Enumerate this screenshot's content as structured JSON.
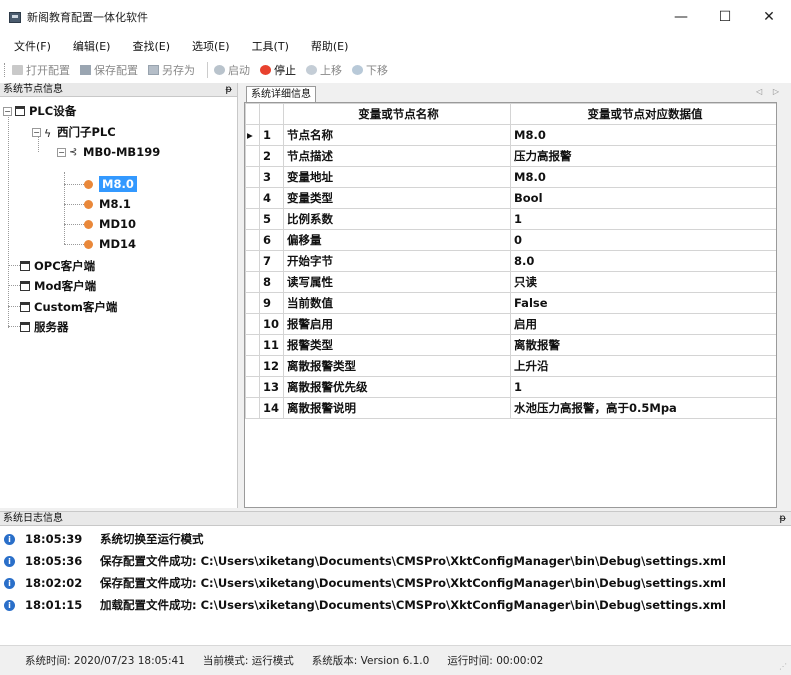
{
  "window": {
    "title": "新阁教育配置一体化软件",
    "controls": {
      "minimize": "—",
      "maximize": "☐",
      "close": "✕"
    }
  },
  "menu": [
    {
      "label": "文件(F)"
    },
    {
      "label": "编辑(E)"
    },
    {
      "label": "查找(E)"
    },
    {
      "label": "选项(E)"
    },
    {
      "label": "工具(T)"
    },
    {
      "label": "帮助(E)"
    }
  ],
  "toolbar": {
    "open": "打开配置",
    "save": "保存配置",
    "save_as": "另存为",
    "start": "启动",
    "stop": "停止",
    "move_up": "上移",
    "move_down": "下移"
  },
  "tree_panel": {
    "title": "系统节点信息",
    "pin": "ᵽ",
    "nodes": {
      "plc_devices": "PLC设备",
      "siemens_plc": "西门子PLC",
      "group": "MB0-MB199",
      "tag_1": "M8.0",
      "tag_2": "M8.1",
      "tag_3": "MD10",
      "tag_4": "MD14",
      "opc": "OPC客户端",
      "mod": "Mod客户端",
      "custom": "Custom客户端",
      "server": "服务器"
    }
  },
  "detail_panel": {
    "tab": "系统详细信息",
    "tab_nav": "◁ ▷",
    "columns": [
      "变量或节点名称",
      "变量或节点对应数据值"
    ],
    "current_row_marker": "▸",
    "rows": [
      {
        "idx": "1",
        "name": "节点名称",
        "value": "M8.0"
      },
      {
        "idx": "2",
        "name": "节点描述",
        "value": "压力高报警"
      },
      {
        "idx": "3",
        "name": "变量地址",
        "value": "M8.0"
      },
      {
        "idx": "4",
        "name": "变量类型",
        "value": "Bool"
      },
      {
        "idx": "5",
        "name": "比例系数",
        "value": "1"
      },
      {
        "idx": "6",
        "name": "偏移量",
        "value": "0"
      },
      {
        "idx": "7",
        "name": "开始字节",
        "value": "8.0"
      },
      {
        "idx": "8",
        "name": "读写属性",
        "value": "只读"
      },
      {
        "idx": "9",
        "name": "当前数值",
        "value": "False"
      },
      {
        "idx": "10",
        "name": "报警启用",
        "value": "启用"
      },
      {
        "idx": "11",
        "name": "报警类型",
        "value": "离散报警"
      },
      {
        "idx": "12",
        "name": "离散报警类型",
        "value": "上升沿"
      },
      {
        "idx": "13",
        "name": "离散报警优先级",
        "value": "1"
      },
      {
        "idx": "14",
        "name": "离散报警说明",
        "value": "水池压力高报警，高于0.5Mpa"
      }
    ]
  },
  "log_panel": {
    "title": "系统日志信息",
    "pin": "ᵽ",
    "entries": [
      {
        "time": "18:05:39",
        "message": "系统切换至运行模式"
      },
      {
        "time": "18:05:36",
        "message": "保存配置文件成功: C:\\Users\\xiketang\\Documents\\CMSPro\\XktConfigManager\\bin\\Debug\\settings.xml"
      },
      {
        "time": "18:02:02",
        "message": "保存配置文件成功: C:\\Users\\xiketang\\Documents\\CMSPro\\XktConfigManager\\bin\\Debug\\settings.xml"
      },
      {
        "time": "18:01:15",
        "message": "加载配置文件成功: C:\\Users\\xiketang\\Documents\\CMSPro\\XktConfigManager\\bin\\Debug\\settings.xml"
      }
    ]
  },
  "status_bar": {
    "system_time": "系统时间:  2020/07/23 18:05:41",
    "current_mode": "当前模式:  运行模式",
    "version": "系统版本:  Version  6.1.0",
    "run_time": "运行时间:  00:00:02"
  }
}
